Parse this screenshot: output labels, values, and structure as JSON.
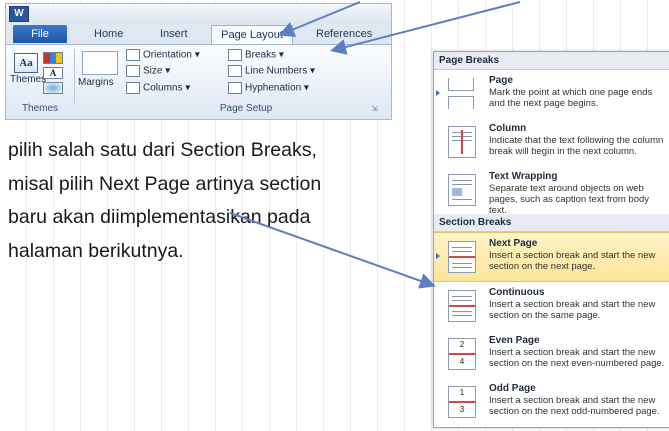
{
  "ribbon": {
    "app_icon": "W",
    "tabs": [
      "File",
      "Home",
      "Insert",
      "Page Layout",
      "References"
    ],
    "themes": {
      "label": "Themes",
      "group": "Themes"
    },
    "margins_label": "Margins",
    "orientation_label": "Orientation",
    "size_label": "Size",
    "columns_label": "Columns",
    "breaks_label": "Breaks",
    "line_numbers_label": "Line Numbers",
    "hyphenation_label": "Hyphenation",
    "page_setup_group": "Page Setup"
  },
  "description": "pilih salah satu dari Section Breaks, misal pilih Next Page artinya section baru akan diimplementasikan pada halaman berikutnya.",
  "menu": {
    "page_breaks_header": "Page Breaks",
    "section_breaks_header": "Section Breaks",
    "page_breaks": [
      {
        "title": "Page",
        "desc": "Mark the point at which one page ends and the next page begins."
      },
      {
        "title": "Column",
        "desc": "Indicate that the text following the column break will begin in the next column."
      },
      {
        "title": "Text Wrapping",
        "desc": "Separate text around objects on web pages, such as caption text from body text."
      }
    ],
    "section_breaks": [
      {
        "title": "Next Page",
        "desc": "Insert a section break and start the new section on the next page."
      },
      {
        "title": "Continuous",
        "desc": "Insert a section break and start the new section on the same page."
      },
      {
        "title": "Even Page",
        "desc": "Insert a section break and start the new section on the next even-numbered page."
      },
      {
        "title": "Odd Page",
        "desc": "Insert a section break and start the new section on the next odd-numbered page."
      }
    ],
    "icon_numbers": {
      "even": "2",
      "even_next": "4",
      "odd": "1",
      "odd_next": "3"
    }
  },
  "colors": {
    "arrow": "#5b7fc0",
    "selected_bg": "#fde59a",
    "file_tab": "#2b5fb0"
  }
}
